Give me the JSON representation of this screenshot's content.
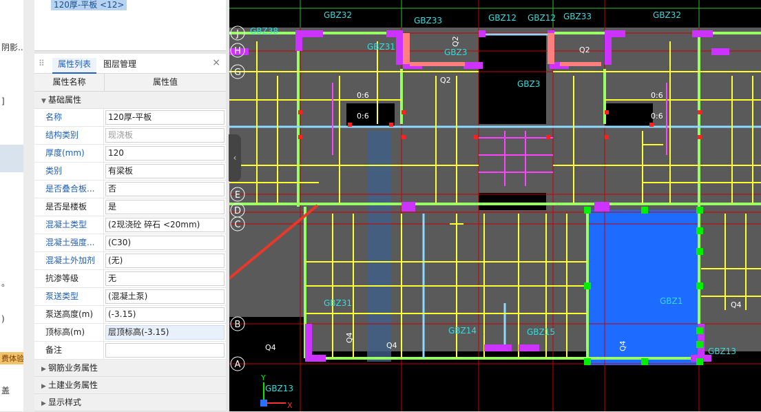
{
  "left_strip": {
    "fragments": [
      "阴影...",
      "]",
      "。",
      ")",
      "盖"
    ],
    "badge": "费体验"
  },
  "layer_list": {
    "selected_item": "120厚-平板 <12>"
  },
  "panel": {
    "tabs": [
      {
        "label": "属性列表",
        "active": true
      },
      {
        "label": "图层管理",
        "active": false
      }
    ],
    "close_glyph": "×",
    "headers": {
      "name": "属性名称",
      "value": "属性值"
    },
    "groups": [
      {
        "label": "基础属性",
        "expanded": true
      },
      {
        "label": "钢筋业务属性",
        "expanded": false
      },
      {
        "label": "土建业务属性",
        "expanded": false
      },
      {
        "label": "显示样式",
        "expanded": false
      }
    ],
    "properties": [
      {
        "name": "名称",
        "value": "120厚-平板"
      },
      {
        "name": "结构类别",
        "value": "现浇板"
      },
      {
        "name": "厚度(mm)",
        "value": "120"
      },
      {
        "name": "类别",
        "value": "有梁板"
      },
      {
        "name": "是否叠合板...",
        "value": "否"
      },
      {
        "name": "是否是楼板",
        "value": "是"
      },
      {
        "name": "混凝土类型",
        "value": "(2现浇砼 碎石 <20mm)"
      },
      {
        "name": "混凝土强度...",
        "value": "(C30)"
      },
      {
        "name": "混凝土外加剂",
        "value": "(无)"
      },
      {
        "name": "抗渗等级",
        "value": "无"
      },
      {
        "name": "泵送类型",
        "value": "(混凝土泵)"
      },
      {
        "name": "泵送高度(m)",
        "value": "(-3.15)"
      },
      {
        "name": "顶标高(m)",
        "value": "层顶标高(-3.15)"
      },
      {
        "name": "备注",
        "value": ""
      }
    ]
  },
  "cad": {
    "axis_labels": [
      "J",
      "H",
      "G",
      "E",
      "D",
      "C",
      "B",
      "A"
    ],
    "component_labels": [
      "GBZ38",
      "GBZ32",
      "GBZ33",
      "GBZ12",
      "GBZ12",
      "GBZ33",
      "GBZ32",
      "GBZ31",
      "GBZ3",
      "Q2",
      "Q2",
      "Q2",
      "GBZ3",
      "GBZ13",
      "Q4",
      "Q4",
      "Q4",
      "Q4",
      "Q4",
      "GBZ13",
      "GBZ14",
      "GBZ15",
      "GBZ31",
      "GBZ1"
    ],
    "dim_labels": [
      "0:6",
      "0:6",
      "0:6",
      "0:6"
    ],
    "ucs": {
      "x": "X",
      "y": "Y"
    },
    "colors": {
      "background": "#000000",
      "slab": "#5a5a5a",
      "beam": "#ffff33",
      "wall": "#99ff66",
      "column": "#cc33ff",
      "selected_slab": "#1e6bff",
      "axis": "#cc0000"
    }
  }
}
